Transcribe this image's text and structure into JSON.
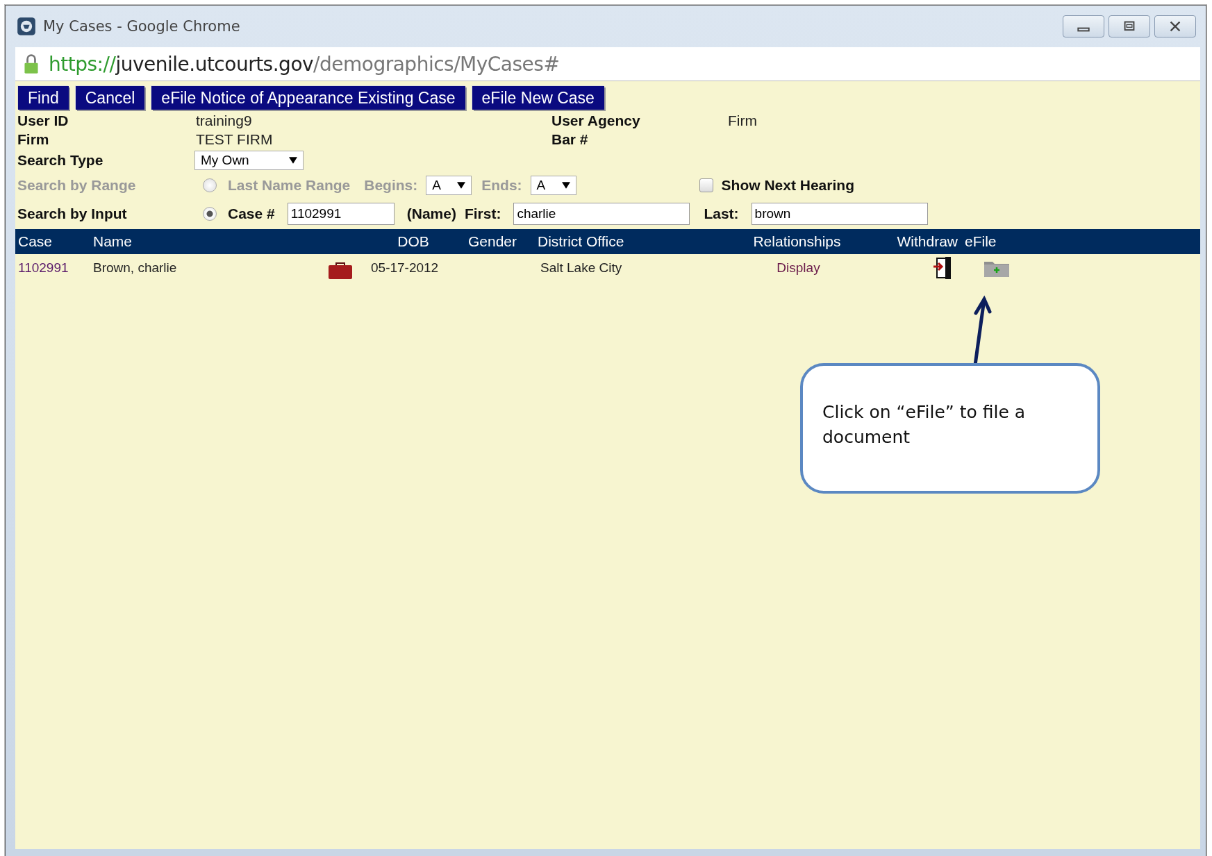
{
  "window": {
    "title": "My Cases - Google Chrome"
  },
  "address_bar": {
    "scheme": "https://",
    "host": "juvenile.utcourts.gov",
    "path": "/demographics/MyCases#"
  },
  "toolbar": [
    "Find",
    "Cancel",
    "eFile Notice of Appearance Existing Case",
    "eFile New Case"
  ],
  "info": [
    {
      "label": "User ID",
      "value": "training9"
    },
    {
      "label": "User Agency",
      "value": "Firm"
    },
    {
      "label": "Firm",
      "value": "TEST FIRM"
    },
    {
      "label": "Bar #"
    }
  ],
  "search_type": {
    "label": "Search Type",
    "value": "My Own"
  },
  "search_by_range": {
    "label": "Search by Range",
    "disabled": true,
    "radio": {
      "label": "Last Name Range",
      "selected": false
    },
    "begins": {
      "label": "Begins:",
      "value": "A"
    },
    "ends": {
      "label": "Ends:",
      "value": "A"
    },
    "show_next_hearing": {
      "label": "Show Next Hearing",
      "checked": false
    }
  },
  "search_by_input": {
    "label": "Search by Input",
    "radio": {
      "label": "Case #",
      "selected": true
    },
    "case_number": "1102991",
    "name_label": "(Name)",
    "first": {
      "label": "First:",
      "value": "charlie"
    },
    "last": {
      "label": "Last:",
      "value": "brown"
    }
  },
  "table": {
    "columns": [
      "Case",
      "Name",
      "DOB",
      "Gender",
      "District Office",
      "Relationships",
      "Withdraw",
      "eFile"
    ],
    "rows": [
      {
        "case": "1102991",
        "name": "Brown, charlie",
        "dob": "05-17-2012",
        "district_office": "Salt Lake City",
        "relationships": "Display"
      }
    ]
  },
  "callout": {
    "text": "Click on “eFile” to file a document"
  }
}
